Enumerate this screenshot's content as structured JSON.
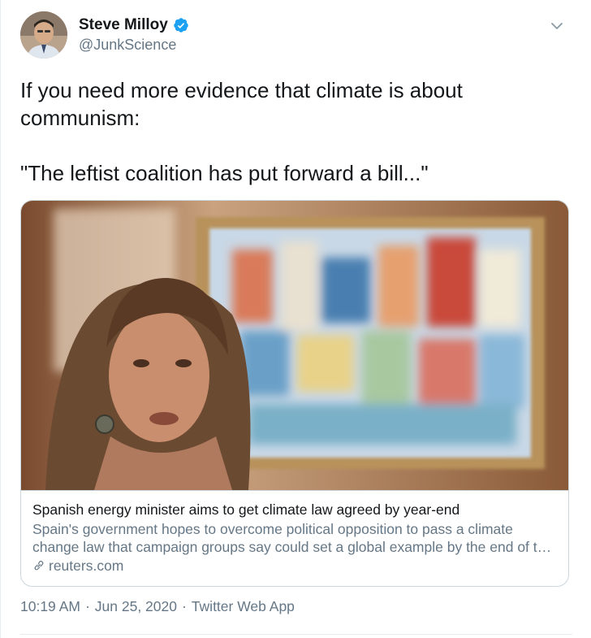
{
  "user": {
    "display_name": "Steve Milloy",
    "handle": "@JunkScience",
    "verified": true,
    "avatar_icon": "profile-photo"
  },
  "menu": {
    "icon": "chevron-down-icon"
  },
  "tweet": {
    "text": "If you need more evidence that climate is about communism:\n\n\"The leftist coalition has put forward a bill...\""
  },
  "card": {
    "image_alt": "woman speaking in front of a colorful painting of houses",
    "title": "Spanish energy minister aims to get climate law agreed by year-end",
    "description": "Spain's government hopes to overcome political opposition to pass a climate change law that campaign groups say could set a global example by the end of the year.",
    "domain": "reuters.com",
    "domain_icon": "link-icon"
  },
  "meta": {
    "time": "10:19 AM",
    "sep1": "·",
    "date": "Jun 25, 2020",
    "sep2": "·",
    "source": "Twitter Web App"
  },
  "colors": {
    "accent": "#1da1f2",
    "text_primary": "#14171a",
    "text_secondary": "#657786",
    "border": "#ccd6dd"
  }
}
